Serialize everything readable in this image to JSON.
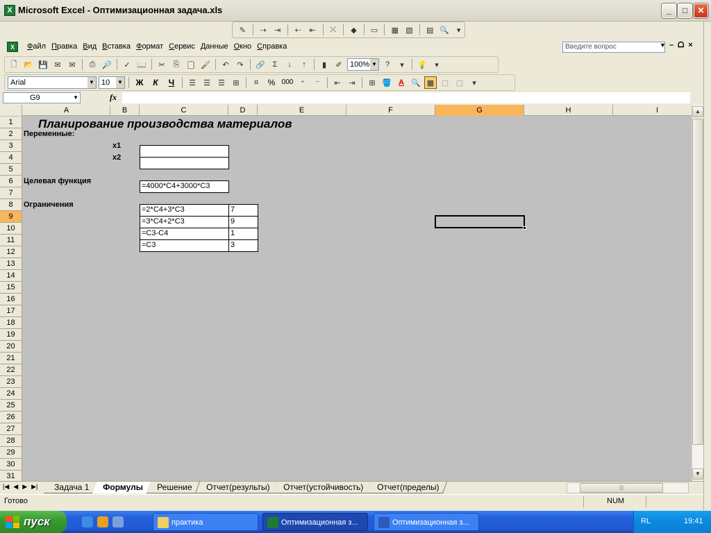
{
  "window": {
    "title": "Microsoft Excel - Оптимизационная задача.xls",
    "controls": [
      "_",
      "□",
      "✕"
    ]
  },
  "menu": {
    "items": [
      "Файл",
      "Правка",
      "Вид",
      "Вставка",
      "Формат",
      "Сервис",
      "Данные",
      "Окно",
      "Справка"
    ],
    "ask_placeholder": "Введите вопрос",
    "mdi_controls": [
      "–",
      "ᗝ",
      "×"
    ]
  },
  "standard_toolbar": {
    "zoom": "100%"
  },
  "formatting_toolbar": {
    "font": "Arial",
    "size": "10",
    "bold": "Ж",
    "italic": "К",
    "underline": "Ч",
    "percent": "%",
    "thousands": "000"
  },
  "formula_bar": {
    "name_box": "G9",
    "fx": "fx",
    "content": ""
  },
  "columns": [
    "A",
    "B",
    "C",
    "D",
    "E",
    "F",
    "G",
    "H",
    "I"
  ],
  "selected_column": "G",
  "rows": [
    "1",
    "2",
    "3",
    "4",
    "5",
    "6",
    "7",
    "8",
    "9",
    "10",
    "11",
    "12",
    "13",
    "14",
    "15",
    "16",
    "17",
    "18",
    "19",
    "20",
    "21",
    "22",
    "23",
    "24",
    "25",
    "26",
    "27",
    "28",
    "29",
    "30",
    "31"
  ],
  "selected_row": "9",
  "sheet": {
    "title": "Планирование производства материалов",
    "variables_label": "Переменные:",
    "x1_label": "x1",
    "x2_label": "x2",
    "x1_value": "",
    "x2_value": "",
    "objective_label": "Целевая функция",
    "objective_formula": "=4000*C4+3000*C3",
    "constraints_label": "Ограничения",
    "constraints": [
      {
        "formula": "=2*C4+3*C3",
        "value": "7"
      },
      {
        "formula": "=3*C4+2*C3",
        "value": "9"
      },
      {
        "formula": "=C3-C4",
        "value": "1"
      },
      {
        "formula": "=C3",
        "value": "3"
      }
    ]
  },
  "sheet_tabs": {
    "tabs": [
      "Задача 1",
      "Формулы",
      "Решение",
      "Отчет(результы)",
      "Отчет(устойчивость)",
      "Отчет(пределы)"
    ],
    "active": "Формулы"
  },
  "status_bar": {
    "status": "Готово",
    "num": "NUM"
  },
  "taskbar": {
    "start": "пуск",
    "buttons": [
      "практика",
      "Оптимизационная з...",
      "Оптимизационная з..."
    ],
    "lang": "RL",
    "time": "19:41"
  }
}
